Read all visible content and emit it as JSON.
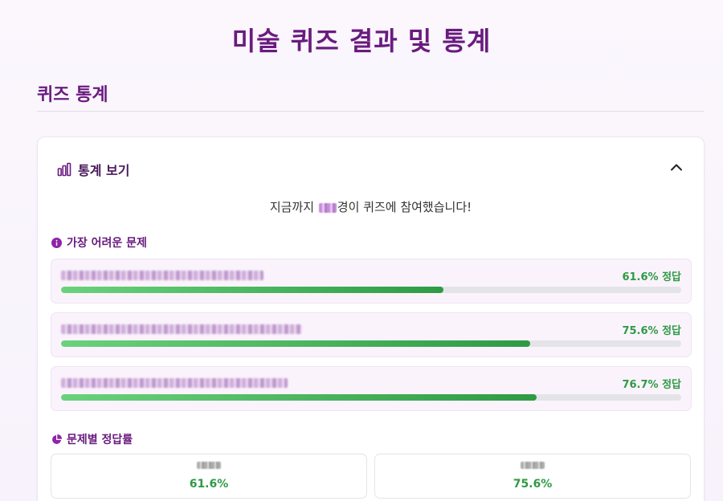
{
  "page": {
    "title": "미술 퀴즈 결과 및 통계"
  },
  "section": {
    "title": "퀴즈 통계"
  },
  "stats_card": {
    "header_label": "통계 보기",
    "participants_prefix": "지금까지 ",
    "participants_suffix": "경이 퀴즈에 참여했습니다!",
    "participants_count_redacted": true
  },
  "hardest": {
    "heading": "가장 어려운 문제",
    "items": [
      {
        "question_redacted": true,
        "rate": 0.616,
        "rate_text": "61.6% 정답"
      },
      {
        "question_redacted": true,
        "rate": 0.756,
        "rate_text": "75.6% 정답"
      },
      {
        "question_redacted": true,
        "rate": 0.767,
        "rate_text": "76.7% 정답"
      }
    ]
  },
  "per_question": {
    "heading": "문제별 정답률",
    "cards": [
      {
        "label_redacted": true,
        "rate_text": "61.6%"
      },
      {
        "label_redacted": true,
        "rate_text": "75.6%"
      }
    ]
  },
  "colors": {
    "brand_purple": "#6a1b7f",
    "success_green": "#2e9a44",
    "item_background": "#faf3fc"
  },
  "icons": {
    "stats_header": "bar-chart-icon",
    "collapse": "chevron-up-icon",
    "hardest_heading": "info-circle-icon",
    "per_question_heading": "pie-chart-icon"
  }
}
